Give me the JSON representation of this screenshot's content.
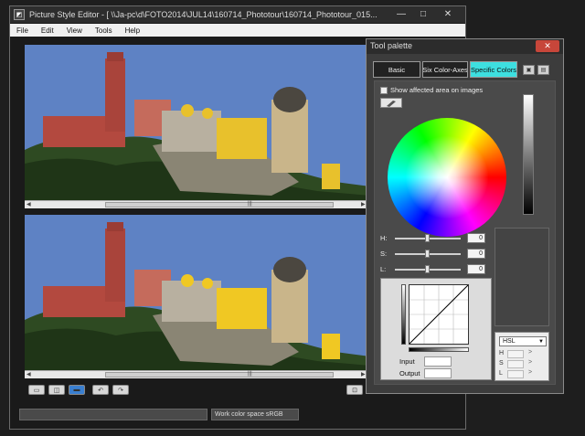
{
  "window": {
    "title": "Picture Style Editor - [ \\\\Ja-pc\\d\\FOTO2014\\JUL14\\160714_Phototour\\160714_Phototour_015...",
    "minimize": "—",
    "maximize": "□",
    "close": "✕"
  },
  "menu": [
    "File",
    "Edit",
    "View",
    "Tools",
    "Help"
  ],
  "status": {
    "work_color_space": "Work color space  sRGB"
  },
  "scrollbar": {
    "left_arrow": "◀",
    "right_arrow": "▶",
    "grip": "|||"
  },
  "toolbar_icons": [
    "single-view-icon",
    "side-by-side-icon",
    "split-view-icon",
    "rotate-left-icon",
    "rotate-right-icon",
    "fit-icon",
    "zoom-icon"
  ],
  "tool_palette": {
    "title": "Tool palette",
    "close": "✕",
    "tabs": [
      "Basic",
      "Six Color-Axes",
      "Specific Colors"
    ],
    "active_tab": "Specific Colors",
    "show_affected_label": "Show affected area on images",
    "sliders": [
      {
        "label": "H:",
        "value": "0",
        "position": 0.5
      },
      {
        "label": "S:",
        "value": "0",
        "position": 0.5
      },
      {
        "label": "L:",
        "value": "0",
        "position": 0.5
      }
    ],
    "input_label": "Input",
    "output_label": "Output",
    "hsl_mode": "HSL",
    "hsl_rows": [
      {
        "k": "H",
        "arrow": ">"
      },
      {
        "k": "S",
        "arrow": ">"
      },
      {
        "k": "L",
        "arrow": ">"
      }
    ]
  },
  "colors": {
    "active_tab": "#3ddfe0",
    "close_button": "#c7463a",
    "sky": "#5e82c4",
    "castle_red": "#b3493f",
    "castle_yellow": "#e8c12c"
  }
}
